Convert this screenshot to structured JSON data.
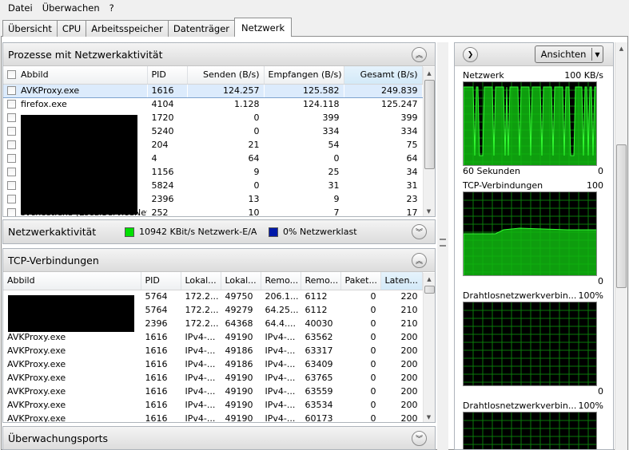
{
  "menu": [
    "Datei",
    "Überwachen",
    "?"
  ],
  "tabs": [
    {
      "label": "Übersicht",
      "active": false
    },
    {
      "label": "CPU",
      "active": false
    },
    {
      "label": "Arbeitsspeicher",
      "active": false
    },
    {
      "label": "Datenträger",
      "active": false
    },
    {
      "label": "Netzwerk",
      "active": true
    }
  ],
  "processes": {
    "title": "Prozesse mit Netzwerkaktivität",
    "columns": [
      "Abbild",
      "PID",
      "Senden (B/s)",
      "Empfangen (B/s)",
      "Gesamt (B/s)"
    ],
    "rows": [
      [
        "AVKProxy.exe",
        "1616",
        "124.257",
        "125.582",
        "249.839"
      ],
      [
        "firefox.exe",
        "4104",
        "1.128",
        "124.118",
        "125.247"
      ],
      [
        "",
        "1720",
        "0",
        "399",
        "399"
      ],
      [
        "",
        "5240",
        "0",
        "334",
        "334"
      ],
      [
        "",
        "204",
        "21",
        "54",
        "75"
      ],
      [
        "",
        "4",
        "64",
        "0",
        "64"
      ],
      [
        "",
        "1156",
        "9",
        "25",
        "34"
      ],
      [
        "",
        "5824",
        "0",
        "31",
        "31"
      ],
      [
        "",
        "2396",
        "13",
        "9",
        "23"
      ],
      [
        "svchost.exe (LocalServiceNet...",
        "252",
        "10",
        "7",
        "17"
      ]
    ]
  },
  "activity": {
    "title": "Netzwerkaktivität",
    "io_label": "10942 KBit/s Netzwerk-E/A",
    "load_label": "0% Netzwerklast",
    "io_color": "#00e000",
    "load_color": "#0018a8"
  },
  "tcp": {
    "title": "TCP-Verbindungen",
    "columns": [
      "Abbild",
      "PID",
      "Lokal...",
      "Lokal...",
      "Remo...",
      "Remo...",
      "Paket...",
      "Laten..."
    ],
    "rows": [
      [
        "",
        "5764",
        "172.2...",
        "49750",
        "206.1...",
        "6112",
        "0",
        "220"
      ],
      [
        "",
        "5764",
        "172.2...",
        "49279",
        "64.25...",
        "6112",
        "0",
        "210"
      ],
      [
        "",
        "2396",
        "172.2...",
        "64368",
        "64.4....",
        "40030",
        "0",
        "210"
      ],
      [
        "AVKProxy.exe",
        "1616",
        "IPv4-...",
        "49190",
        "IPv4-...",
        "63562",
        "0",
        "200"
      ],
      [
        "AVKProxy.exe",
        "1616",
        "IPv4-...",
        "49186",
        "IPv4-...",
        "63317",
        "0",
        "200"
      ],
      [
        "AVKProxy.exe",
        "1616",
        "IPv4-...",
        "49186",
        "IPv4-...",
        "63409",
        "0",
        "200"
      ],
      [
        "AVKProxy.exe",
        "1616",
        "IPv4-...",
        "49190",
        "IPv4-...",
        "63765",
        "0",
        "200"
      ],
      [
        "AVKProxy.exe",
        "1616",
        "IPv4-...",
        "49190",
        "IPv4-...",
        "63559",
        "0",
        "200"
      ],
      [
        "AVKProxy.exe",
        "1616",
        "IPv4-...",
        "49190",
        "IPv4-...",
        "63534",
        "0",
        "200"
      ],
      [
        "AVKProxy.exe",
        "1616",
        "IPv4-...",
        "49190",
        "IPv4-...",
        "60173",
        "0",
        "200"
      ]
    ]
  },
  "ports": {
    "title": "Überwachungsports"
  },
  "right": {
    "view_button": "Ansichten",
    "graphs": [
      {
        "title": "Netzwerk",
        "max": "100 KB/s",
        "foot_left": "60 Sekunden",
        "foot_right": "0"
      },
      {
        "title": "TCP-Verbindungen",
        "max": "100",
        "foot_left": "",
        "foot_right": "0"
      },
      {
        "title": "Drahtlosnetzwerkverbin...",
        "max": "100%",
        "foot_left": "",
        "foot_right": "0"
      },
      {
        "title": "Drahtlosnetzwerkverbin...",
        "max": "100%",
        "foot_left": "",
        "foot_right": ""
      }
    ]
  }
}
